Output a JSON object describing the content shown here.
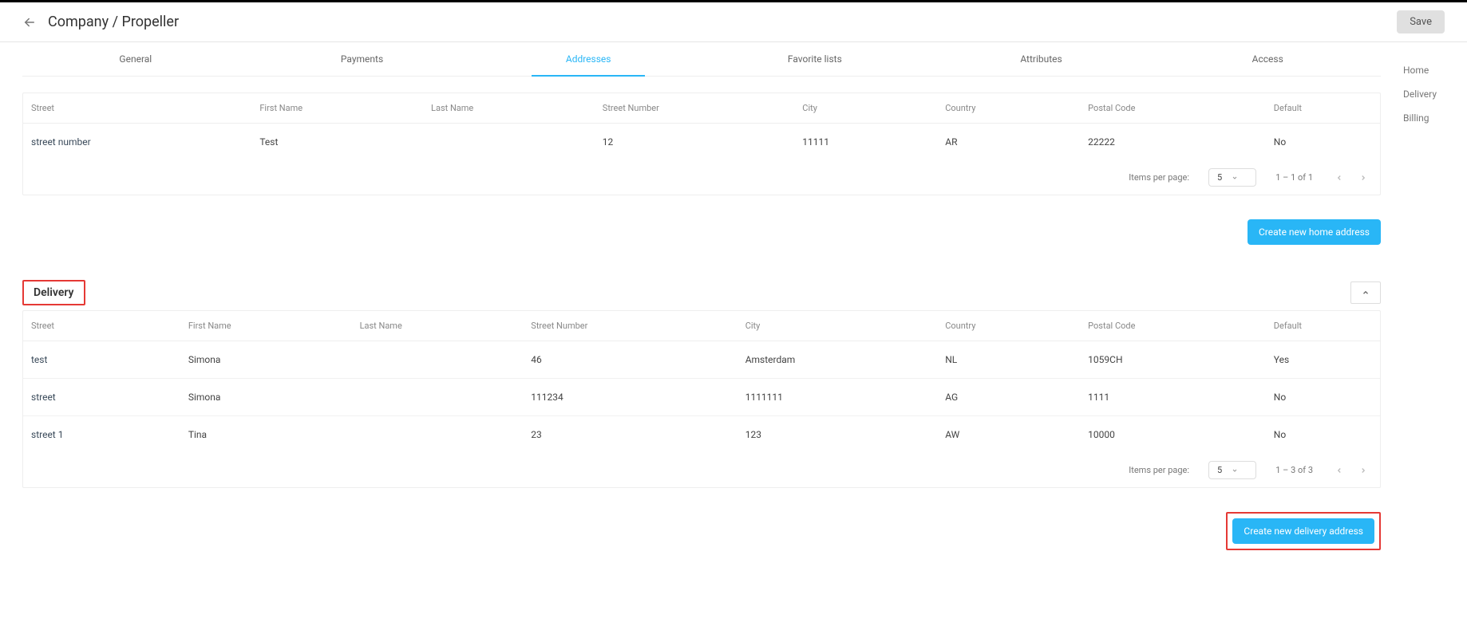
{
  "header": {
    "title": "Company / Propeller",
    "save_label": "Save"
  },
  "tabs": [
    "General",
    "Payments",
    "Addresses",
    "Favorite lists",
    "Attributes",
    "Access"
  ],
  "active_tab_index": 2,
  "side_nav": [
    "Home",
    "Delivery",
    "Billing"
  ],
  "home_section": {
    "columns": [
      "Street",
      "First Name",
      "Last Name",
      "Street Number",
      "City",
      "Country",
      "Postal Code",
      "Default"
    ],
    "rows": [
      {
        "street": "street number",
        "first_name": "Test",
        "last_name": "",
        "street_number": "12",
        "city": "11111",
        "country": "AR",
        "postal_code": "22222",
        "default": "No"
      }
    ],
    "items_per_page_label": "Items per page:",
    "items_per_page_value": "5",
    "range_label": "1 – 1 of 1",
    "create_button": "Create new home address"
  },
  "delivery_section": {
    "title": "Delivery",
    "columns": [
      "Street",
      "First Name",
      "Last Name",
      "Street Number",
      "City",
      "Country",
      "Postal Code",
      "Default"
    ],
    "rows": [
      {
        "street": "test",
        "first_name": "Simona",
        "last_name": "",
        "street_number": "46",
        "city": "Amsterdam",
        "country": "NL",
        "postal_code": "1059CH",
        "default": "Yes"
      },
      {
        "street": "street",
        "first_name": "Simona",
        "last_name": "",
        "street_number": "111234",
        "city": "1111111",
        "country": "AG",
        "postal_code": "1111",
        "default": "No"
      },
      {
        "street": "street 1",
        "first_name": "Tina",
        "last_name": "",
        "street_number": "23",
        "city": "123",
        "country": "AW",
        "postal_code": "10000",
        "default": "No"
      }
    ],
    "items_per_page_label": "Items per page:",
    "items_per_page_value": "5",
    "range_label": "1 – 3 of 3",
    "create_button": "Create new delivery address"
  }
}
